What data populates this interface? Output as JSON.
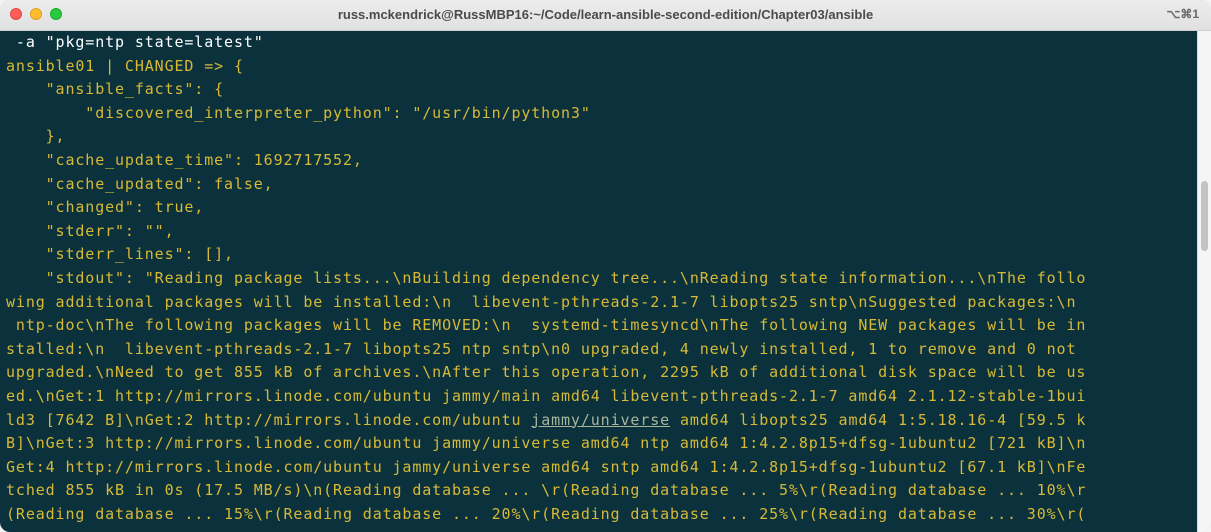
{
  "window": {
    "title": "russ.mckendrick@RussMBP16:~/Code/learn-ansible-second-edition/Chapter03/ansible",
    "shortcut": "⌥⌘1"
  },
  "terminal": {
    "command_line": " -a \"pkg=ntp state=latest\"",
    "lines": [
      "ansible01 | CHANGED => {",
      "    \"ansible_facts\": {",
      "        \"discovered_interpreter_python\": \"/usr/bin/python3\"",
      "    },",
      "    \"cache_update_time\": 1692717552,",
      "    \"cache_updated\": false,",
      "    \"changed\": true,",
      "    \"stderr\": \"\",",
      "    \"stderr_lines\": [],",
      "    \"stdout\": \"Reading package lists...\\nBuilding dependency tree...\\nReading state information...\\nThe follo",
      "wing additional packages will be installed:\\n  libevent-pthreads-2.1-7 libopts25 sntp\\nSuggested packages:\\n",
      " ntp-doc\\nThe following packages will be REMOVED:\\n  systemd-timesyncd\\nThe following NEW packages will be in",
      "stalled:\\n  libevent-pthreads-2.1-7 libopts25 ntp sntp\\n0 upgraded, 4 newly installed, 1 to remove and 0 not",
      "upgraded.\\nNeed to get 855 kB of archives.\\nAfter this operation, 2295 kB of additional disk space will be us",
      "ed.\\nGet:1 http://mirrors.linode.com/ubuntu jammy/main amd64 libevent-pthreads-2.1-7 amd64 2.1.12-stable-1bui",
      "ld3 [7642 B]\\nGet:2 http://mirrors.linode.com/ubuntu "
    ],
    "link_text": "jammy/universe",
    "line16_after_link": " amd64 libopts25 amd64 1:5.18.16-4 [59.5 k",
    "lines_after": [
      "B]\\nGet:3 http://mirrors.linode.com/ubuntu jammy/universe amd64 ntp amd64 1:4.2.8p15+dfsg-1ubuntu2 [721 kB]\\n",
      "Get:4 http://mirrors.linode.com/ubuntu jammy/universe amd64 sntp amd64 1:4.2.8p15+dfsg-1ubuntu2 [67.1 kB]\\nFe",
      "tched 855 kB in 0s (17.5 MB/s)\\n(Reading database ... \\r(Reading database ... 5%\\r(Reading database ... 10%\\r",
      "(Reading database ... 15%\\r(Reading database ... 20%\\r(Reading database ... 25%\\r(Reading database ... 30%\\r("
    ]
  },
  "colors": {
    "background": "#0b323c",
    "text": "#d7b936",
    "command": "#ffffff"
  }
}
